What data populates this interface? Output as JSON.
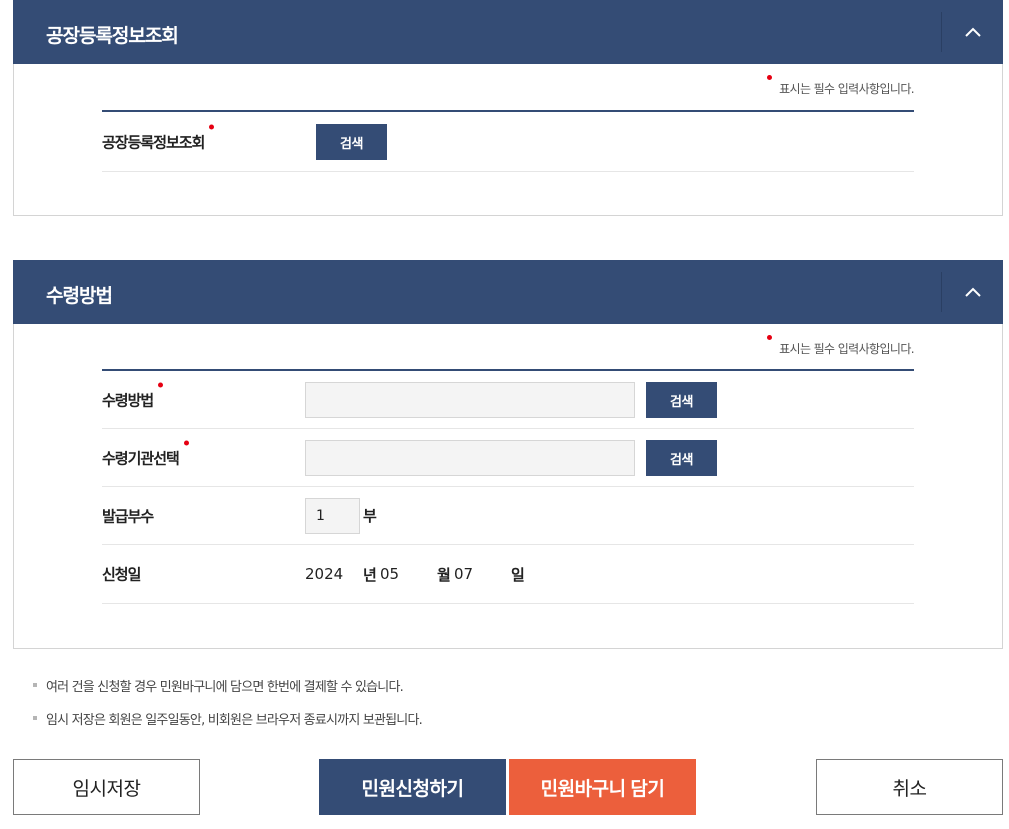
{
  "section_factory": {
    "title": "공장등록정보조회",
    "required_note": "표시는 필수 입력사항입니다.",
    "row_label": "공장등록정보조회",
    "search_button": "검색"
  },
  "section_receipt": {
    "title": "수령방법",
    "required_note": "표시는 필수 입력사항입니다.",
    "receipt_method": {
      "label": "수령방법",
      "value": "",
      "button": "검색"
    },
    "receipt_agency": {
      "label": "수령기관선택",
      "value": "",
      "button": "검색"
    },
    "copies": {
      "label": "발급부수",
      "value": "1",
      "unit": "부"
    },
    "apply_date": {
      "label": "신청일",
      "year": "2024",
      "year_unit": "년",
      "month": "05",
      "month_unit": "월",
      "day": "07",
      "day_unit": "일"
    }
  },
  "notes": [
    "여러 건을 신청할 경우 민원바구니에 담으면 한번에 결제할 수 있습니다.",
    "임시 저장은 회원은 일주일동안, 비회원은 브라우저 종료시까지 보관됩니다."
  ],
  "actions": {
    "temp_save": "임시저장",
    "apply": "민원신청하기",
    "add_to_basket": "민원바구니 담기",
    "cancel": "취소"
  },
  "colors": {
    "header_navy": "#344c75",
    "required_dot": "#e60012",
    "basket_orange": "#ec5f3c"
  }
}
